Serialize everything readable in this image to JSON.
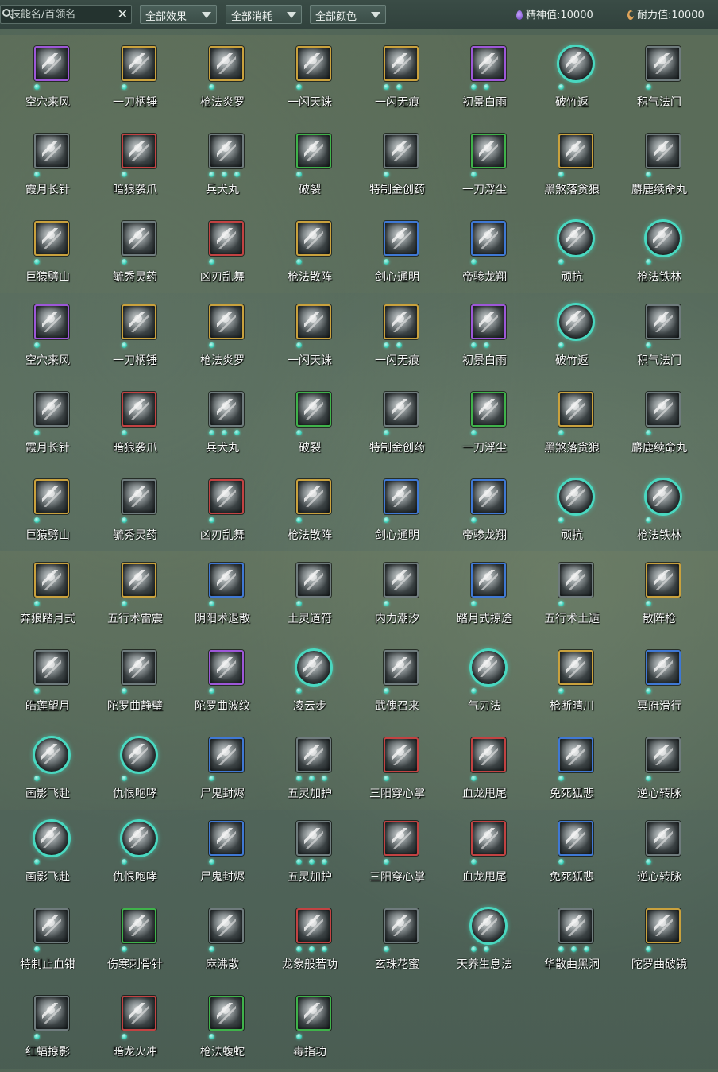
{
  "toolbar": {
    "search_placeholder": "技能名/首领名",
    "clear_glyph": "✕",
    "filters": [
      {
        "label": "全部效果"
      },
      {
        "label": "全部消耗"
      },
      {
        "label": "全部颜色"
      }
    ],
    "spirit": {
      "label": "精神值:10000",
      "icon": "spirit-drop-icon"
    },
    "stamina": {
      "label": "耐力值:10000",
      "icon": "stamina-moon-icon"
    }
  },
  "colors": {
    "purple": "#9d57d8",
    "gold": "#c9a13d",
    "red": "#c24242",
    "green": "#3fb24a",
    "blue": "#3f78d4",
    "teal": "#49d8c0",
    "dot": "#3fd0b8"
  },
  "skills": [
    {
      "name": "空穴来风",
      "frame": "purple",
      "dots": 1
    },
    {
      "name": "一刀柄锤",
      "frame": "gold",
      "dots": 1
    },
    {
      "name": "枪法炎罗",
      "frame": "gold",
      "dots": 1
    },
    {
      "name": "一闪天诛",
      "frame": "gold",
      "dots": 1
    },
    {
      "name": "一闪无痕",
      "frame": "gold",
      "dots": 2
    },
    {
      "name": "初景白雨",
      "frame": "purple",
      "dots": 2
    },
    {
      "name": "破竹返",
      "frame": "teal",
      "dots": 1
    },
    {
      "name": "积气法门",
      "frame": "grey",
      "dots": 1
    },
    {
      "name": "霞月长针",
      "frame": "grey",
      "dots": 1
    },
    {
      "name": "暗狼袭爪",
      "frame": "red",
      "dots": 1
    },
    {
      "name": "兵犬丸",
      "frame": "grey",
      "dots": 3
    },
    {
      "name": "破裂",
      "frame": "green",
      "dots": 1
    },
    {
      "name": "特制金创药",
      "frame": "grey",
      "dots": 1
    },
    {
      "name": "一刀浮尘",
      "frame": "green",
      "dots": 1
    },
    {
      "name": "黑煞落贪狼",
      "frame": "gold",
      "dots": 1
    },
    {
      "name": "麝鹿续命丸",
      "frame": "grey",
      "dots": 1
    },
    {
      "name": "巨猿劈山",
      "frame": "gold",
      "dots": 1
    },
    {
      "name": "毓秀灵药",
      "frame": "grey",
      "dots": 1
    },
    {
      "name": "凶刃乱舞",
      "frame": "red",
      "dots": 1
    },
    {
      "name": "枪法散阵",
      "frame": "gold",
      "dots": 1
    },
    {
      "name": "剑心通明",
      "frame": "blue",
      "dots": 1
    },
    {
      "name": "帝骖龙翔",
      "frame": "blue",
      "dots": 1
    },
    {
      "name": "顽抗",
      "frame": "teal",
      "dots": 1
    },
    {
      "name": "枪法铁林",
      "frame": "teal",
      "dots": 1
    },
    {
      "name": "空穴来风",
      "frame": "purple",
      "dots": 1
    },
    {
      "name": "一刀柄锤",
      "frame": "gold",
      "dots": 1
    },
    {
      "name": "枪法炎罗",
      "frame": "gold",
      "dots": 1
    },
    {
      "name": "一闪天诛",
      "frame": "gold",
      "dots": 1
    },
    {
      "name": "一闪无痕",
      "frame": "gold",
      "dots": 2
    },
    {
      "name": "初景白雨",
      "frame": "purple",
      "dots": 2
    },
    {
      "name": "破竹返",
      "frame": "teal",
      "dots": 1
    },
    {
      "name": "积气法门",
      "frame": "grey",
      "dots": 1
    },
    {
      "name": "霞月长针",
      "frame": "grey",
      "dots": 1
    },
    {
      "name": "暗狼袭爪",
      "frame": "red",
      "dots": 1
    },
    {
      "name": "兵犬丸",
      "frame": "grey",
      "dots": 3
    },
    {
      "name": "破裂",
      "frame": "green",
      "dots": 1
    },
    {
      "name": "特制金创药",
      "frame": "grey",
      "dots": 1
    },
    {
      "name": "一刀浮尘",
      "frame": "green",
      "dots": 1
    },
    {
      "name": "黑煞落贪狼",
      "frame": "gold",
      "dots": 1
    },
    {
      "name": "麝鹿续命丸",
      "frame": "grey",
      "dots": 1
    },
    {
      "name": "巨猿劈山",
      "frame": "gold",
      "dots": 1
    },
    {
      "name": "毓秀灵药",
      "frame": "grey",
      "dots": 1
    },
    {
      "name": "凶刃乱舞",
      "frame": "red",
      "dots": 1
    },
    {
      "name": "枪法散阵",
      "frame": "gold",
      "dots": 1
    },
    {
      "name": "剑心通明",
      "frame": "blue",
      "dots": 1
    },
    {
      "name": "帝骖龙翔",
      "frame": "blue",
      "dots": 1
    },
    {
      "name": "顽抗",
      "frame": "teal",
      "dots": 1
    },
    {
      "name": "枪法铁林",
      "frame": "teal",
      "dots": 1
    },
    {
      "name": "奔狼踏月式",
      "frame": "gold",
      "dots": 1
    },
    {
      "name": "五行术雷震",
      "frame": "gold",
      "dots": 1
    },
    {
      "name": "阴阳术退散",
      "frame": "blue",
      "dots": 1
    },
    {
      "name": "土灵道符",
      "frame": "grey",
      "dots": 1
    },
    {
      "name": "内力潮汐",
      "frame": "grey",
      "dots": 1
    },
    {
      "name": "踏月式掠途",
      "frame": "blue",
      "dots": 1
    },
    {
      "name": "五行术土遁",
      "frame": "grey",
      "dots": 1
    },
    {
      "name": "散阵枪",
      "frame": "gold",
      "dots": 1
    },
    {
      "name": "皓莲望月",
      "frame": "grey",
      "dots": 1
    },
    {
      "name": "陀罗曲静璧",
      "frame": "grey",
      "dots": 1
    },
    {
      "name": "陀罗曲波纹",
      "frame": "purple",
      "dots": 1
    },
    {
      "name": "凌云步",
      "frame": "teal",
      "dots": 1
    },
    {
      "name": "武傀召来",
      "frame": "grey",
      "dots": 1
    },
    {
      "name": "气刃法",
      "frame": "teal",
      "dots": 1
    },
    {
      "name": "枪断晴川",
      "frame": "gold",
      "dots": 1
    },
    {
      "name": "冥府滑行",
      "frame": "blue",
      "dots": 1
    },
    {
      "name": "画影飞赴",
      "frame": "teal",
      "dots": 1
    },
    {
      "name": "仇恨咆哮",
      "frame": "teal",
      "dots": 1
    },
    {
      "name": "尸鬼封烬",
      "frame": "blue",
      "dots": 1
    },
    {
      "name": "五灵加护",
      "frame": "grey",
      "dots": 3
    },
    {
      "name": "三阳穿心掌",
      "frame": "red",
      "dots": 1
    },
    {
      "name": "血龙甩尾",
      "frame": "red",
      "dots": 1
    },
    {
      "name": "免死狐悲",
      "frame": "blue",
      "dots": 1
    },
    {
      "name": "逆心转脉",
      "frame": "grey",
      "dots": 1
    },
    {
      "name": "画影飞赴",
      "frame": "teal",
      "dots": 1
    },
    {
      "name": "仇恨咆哮",
      "frame": "teal",
      "dots": 1
    },
    {
      "name": "尸鬼封烬",
      "frame": "blue",
      "dots": 1
    },
    {
      "name": "五灵加护",
      "frame": "grey",
      "dots": 3
    },
    {
      "name": "三阳穿心掌",
      "frame": "red",
      "dots": 1
    },
    {
      "name": "血龙甩尾",
      "frame": "red",
      "dots": 1
    },
    {
      "name": "免死狐悲",
      "frame": "blue",
      "dots": 1
    },
    {
      "name": "逆心转脉",
      "frame": "grey",
      "dots": 1
    },
    {
      "name": "特制止血钳",
      "frame": "grey",
      "dots": 1
    },
    {
      "name": "伤寒刺骨针",
      "frame": "green",
      "dots": 1
    },
    {
      "name": "麻沸散",
      "frame": "grey",
      "dots": 1
    },
    {
      "name": "龙象般若功",
      "frame": "red",
      "dots": 3
    },
    {
      "name": "玄珠花蜜",
      "frame": "grey",
      "dots": 1
    },
    {
      "name": "天养生息法",
      "frame": "teal",
      "dots": 2
    },
    {
      "name": "华散曲黑洞",
      "frame": "grey",
      "dots": 3
    },
    {
      "name": "陀罗曲破镜",
      "frame": "gold",
      "dots": 1
    },
    {
      "name": "红蝠掠影",
      "frame": "grey",
      "dots": 1
    },
    {
      "name": "暗龙火冲",
      "frame": "red",
      "dots": 1
    },
    {
      "name": "枪法蝮蛇",
      "frame": "green",
      "dots": 1
    },
    {
      "name": "毒指功",
      "frame": "green",
      "dots": 1
    }
  ]
}
